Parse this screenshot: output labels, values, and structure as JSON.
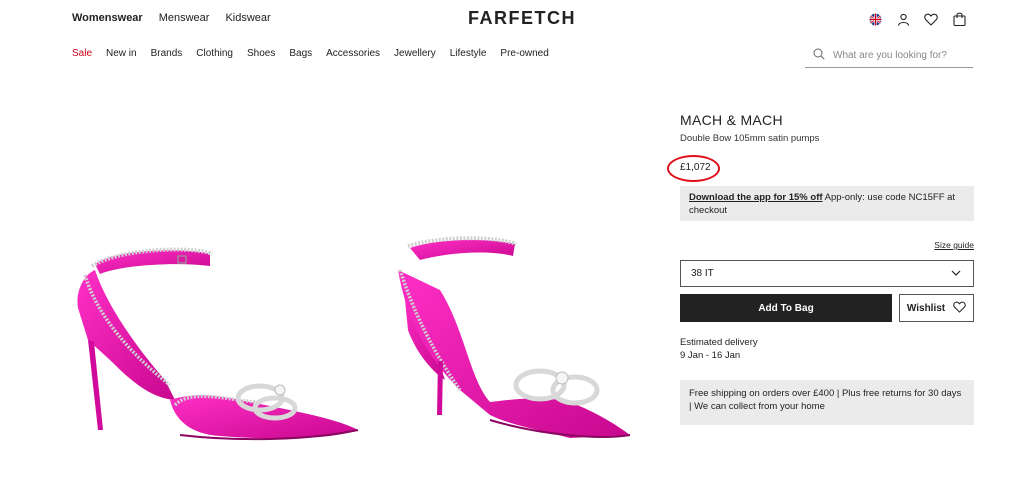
{
  "header": {
    "logo": "FARFETCH",
    "top_nav": [
      "Womenswear",
      "Menswear",
      "Kidswear"
    ],
    "icons": [
      "uk-flag-icon",
      "account-icon",
      "wishlist-heart-icon",
      "bag-icon"
    ]
  },
  "category_nav": [
    "Sale",
    "New in",
    "Brands",
    "Clothing",
    "Shoes",
    "Bags",
    "Accessories",
    "Jewellery",
    "Lifestyle",
    "Pre-owned"
  ],
  "search": {
    "placeholder": "What are you looking for?"
  },
  "product": {
    "brand": "MACH & MACH",
    "name": "Double Bow 105mm satin pumps",
    "price": "£1,072",
    "promo_link": "Download the app for 15% off",
    "promo_text": " App-only: use code NC15FF at checkout",
    "size_guide": "Size guide",
    "selected_size": "38 IT",
    "add_to_bag": "Add To Bag",
    "wishlist": "Wishlist",
    "delivery_label": "Estimated delivery",
    "delivery_dates": "9 Jan - 16 Jan",
    "shipping_info": "Free shipping on orders over £400 | Plus free returns for 30 days | We can collect from your home"
  },
  "colors": {
    "accent": "#222222",
    "sale": "#d0021b",
    "highlight_circle": "#e0101b",
    "shoe": "#e60ca8"
  }
}
